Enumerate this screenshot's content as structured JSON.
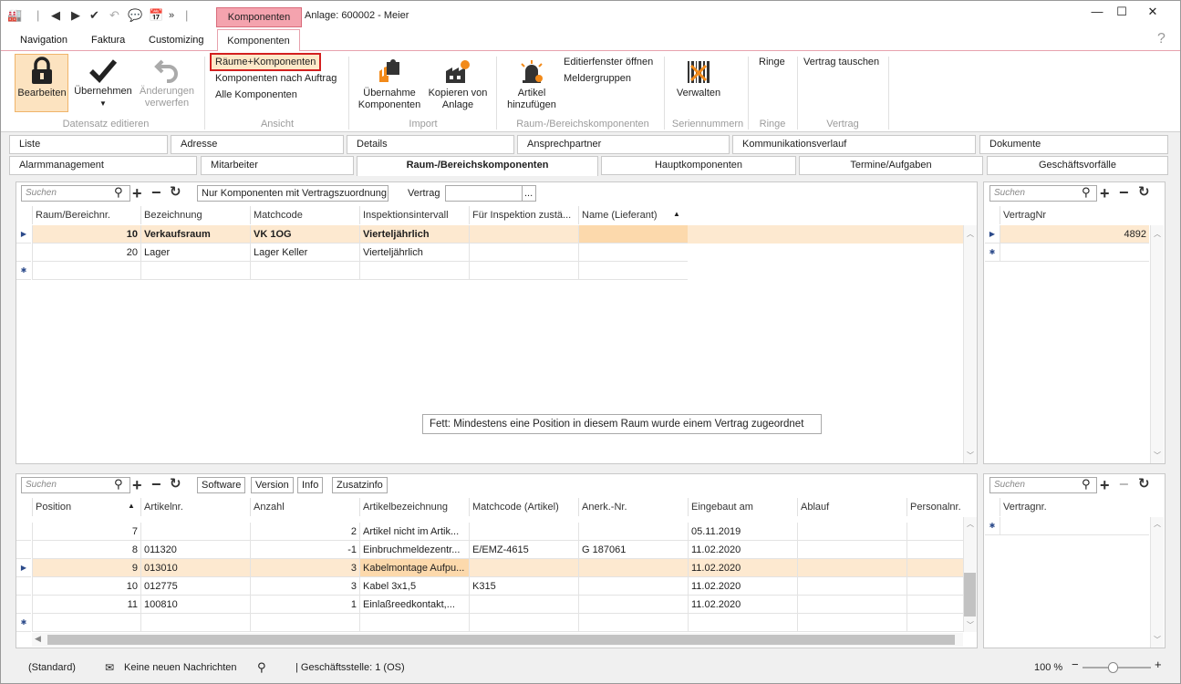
{
  "window": {
    "context_tab": "Komponenten",
    "title": "Anlage: 600002 - Meier",
    "min": "—",
    "max": "☐",
    "close": "✕"
  },
  "ribbon_tabs": [
    "Navigation",
    "Faktura",
    "Customizing",
    "Komponenten"
  ],
  "help_label": "?",
  "ribbon": {
    "datensatz": {
      "bearbeiten": "Bearbeiten",
      "uebernehmen": "Übernehmen",
      "aenderungen_1": "Änderungen",
      "aenderungen_2": "verwerfen",
      "group": "Datensatz editieren"
    },
    "ansicht": {
      "items": [
        "Räume+Komponenten",
        "Komponenten nach Auftrag",
        "Alle Komponenten"
      ],
      "group": "Ansicht"
    },
    "import": {
      "btn1_1": "Übernahme",
      "btn1_2": "Komponenten",
      "btn2_1": "Kopieren von",
      "btn2_2": "Anlage",
      "group": "Import"
    },
    "raum": {
      "btn1_1": "Artikel",
      "btn1_2": "hinzufügen",
      "item1": "Editierfenster öffnen",
      "item2": "Meldergruppen",
      "group": "Raum-/Bereichskomponenten"
    },
    "serien": {
      "btn": "Verwalten",
      "group": "Seriennummern"
    },
    "ringe": {
      "item": "Ringe",
      "group": "Ringe"
    },
    "vertrag": {
      "item": "Vertrag tauschen",
      "group": "Vertrag"
    }
  },
  "page_tabs_row1": [
    "Liste",
    "Adresse",
    "Details",
    "Ansprechpartner",
    "Kommunikationsverlauf",
    "Dokumente"
  ],
  "page_tabs_row2": [
    "Alarmmanagement",
    "Mitarbeiter",
    "Raum-/Bereichskomponenten",
    "Hauptkomponenten",
    "Termine/Aufgaben",
    "Geschäftsvorfälle"
  ],
  "top_grid": {
    "search_placeholder": "Suchen",
    "filter_button": "Nur Komponenten mit Vertragszuordnung",
    "vertrag_label": "Vertrag",
    "vertrag_value": "",
    "ellipsis": "...",
    "headers": [
      "Raum/Bereichnr.",
      "Bezeichnung",
      "Matchcode",
      "Inspektionsintervall",
      "Für Inspektion zustä...",
      "Name (Lieferant)"
    ],
    "rows": [
      {
        "nr": "10",
        "bez": "Verkaufsraum",
        "match": "VK 1OG",
        "intervall": "Vierteljährlich",
        "fuer": "",
        "name": ""
      },
      {
        "nr": "20",
        "bez": "Lager",
        "match": "Lager Keller",
        "intervall": "Vierteljährlich",
        "fuer": "",
        "name": ""
      }
    ],
    "tooltip": "Fett: Mindestens eine Position in diesem Raum wurde einem Vertrag zugeordnet"
  },
  "top_right": {
    "search_placeholder": "Suchen",
    "header": "VertragNr",
    "rows": [
      "4892"
    ]
  },
  "bottom_grid": {
    "search_placeholder": "Suchen",
    "buttons": [
      "Software",
      "Version",
      "Info",
      "Zusatzinfo"
    ],
    "headers": [
      "Position",
      "Artikelnr.",
      "Anzahl",
      "Artikelbezeichnung",
      "Matchcode (Artikel)",
      "Anerk.-Nr.",
      "Eingebaut am",
      "Ablauf",
      "Personalnr."
    ],
    "rows": [
      {
        "pos": "7",
        "art": "",
        "anz": "2",
        "bez": "Artikel nicht im Artik...",
        "match": "",
        "anerk": "",
        "eingebaut": "05.11.2019"
      },
      {
        "pos": "8",
        "art": "011320",
        "anz": "-1",
        "bez": "Einbruchmeldezentr...",
        "match": "E/EMZ-4615",
        "anerk": "G 187061",
        "eingebaut": "11.02.2020"
      },
      {
        "pos": "9",
        "art": "013010",
        "anz": "3",
        "bez": "Kabelmontage Aufpu...",
        "match": "",
        "anerk": "",
        "eingebaut": "11.02.2020"
      },
      {
        "pos": "10",
        "art": "012775",
        "anz": "3",
        "bez": "Kabel 3x1,5",
        "match": "K315",
        "anerk": "",
        "eingebaut": "11.02.2020"
      },
      {
        "pos": "11",
        "art": "100810",
        "anz": "1",
        "bez": "Einlaßreedkontakt,...",
        "match": "",
        "anerk": "",
        "eingebaut": "11.02.2020"
      }
    ]
  },
  "bottom_right": {
    "search_placeholder": "Suchen",
    "header": "Vertragnr."
  },
  "status": {
    "standard": "(Standard)",
    "messages": "Keine neuen Nachrichten",
    "branch": "| Geschäftsstelle:  1 (OS)",
    "zoom": "100 %",
    "zoom_value": 100
  }
}
